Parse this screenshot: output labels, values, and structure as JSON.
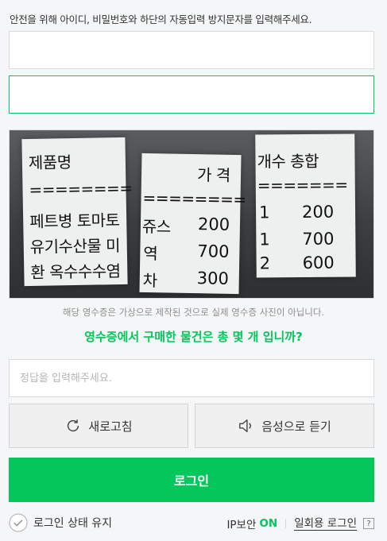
{
  "notice": "안전을 위해 아이디, 비밀번호와 하단의 자동입력 방지문자를 입력해주세요.",
  "captcha": {
    "receipt1": {
      "header": "제품명",
      "dashes": "========",
      "items": [
        "페트병 토마토",
        "유기수산물 미",
        "환 옥수수수염"
      ]
    },
    "receipt2": {
      "header": "가 격",
      "dashes": "========",
      "items": [
        "쥬스",
        "역",
        "차"
      ],
      "values": [
        "200",
        "700",
        "300"
      ]
    },
    "receipt3": {
      "header": "개수  총합",
      "dashes": "=======",
      "counts": [
        "1",
        "1",
        "2"
      ],
      "totals": [
        "200",
        "700",
        "600"
      ]
    },
    "caption_note": "해당 영수증은 가상으로 제작된 것으로 실제 영수증 사진이 아닙니다.",
    "question": "영수증에서 구매한 물건은 총 몇 개 입니까?"
  },
  "answer": {
    "placeholder": "정답을 입력해주세요.",
    "value": ""
  },
  "buttons": {
    "refresh": "새로고침",
    "audio": "음성으로 듣기",
    "login": "로그인"
  },
  "footer": {
    "keep_login": "로그인 상태 유지",
    "ip_security_label": "IP보안",
    "ip_security_state": "ON",
    "onetime_login": "일회용 로그인",
    "help": "?"
  },
  "colors": {
    "accent": "#03c75a",
    "border": "#dadada",
    "background": "#f5f6f7"
  },
  "icons": [
    "refresh-icon",
    "speaker-icon",
    "check-circle-icon",
    "help-icon"
  ]
}
